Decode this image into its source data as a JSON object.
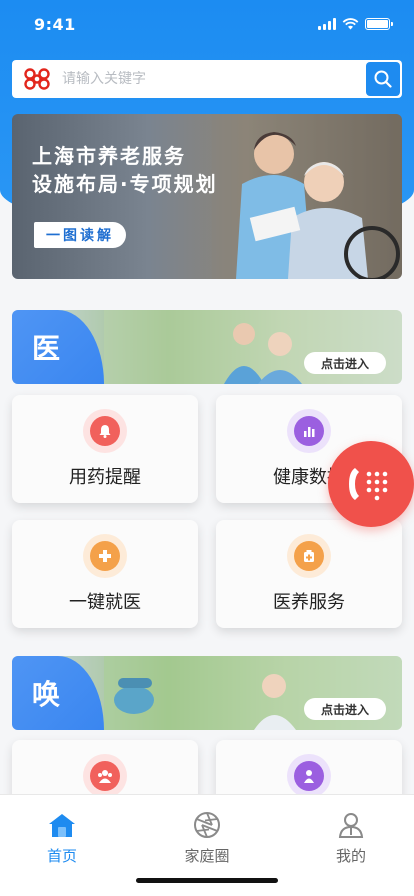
{
  "status": {
    "time": "9:41"
  },
  "search": {
    "placeholder": "请输入关键字",
    "value": ""
  },
  "banner": {
    "title_line1": "上海市养老服务",
    "title_line2": "设施布局·专项规划",
    "button_label": "一图读解"
  },
  "sections": [
    {
      "tag": "医",
      "enter_label": "点击进入"
    },
    {
      "tag": "唤",
      "enter_label": "点击进入"
    }
  ],
  "cards": [
    {
      "label": "用药提醒",
      "icon": "bell-icon",
      "color": "#f1615c",
      "glow": "#fde3e2"
    },
    {
      "label": "健康数据",
      "icon": "bar-chart-icon",
      "color": "#9b5fe0",
      "glow": "#ece2fb"
    },
    {
      "label": "一键就医",
      "icon": "medical-cross-icon",
      "color": "#f4a14a",
      "glow": "#fdebd8"
    },
    {
      "label": "医养服务",
      "icon": "medicine-box-icon",
      "color": "#f4a14a",
      "glow": "#fdebd8"
    },
    {
      "label": "",
      "icon": "group-icon",
      "color": "#f1615c",
      "glow": "#fde3e2"
    },
    {
      "label": "",
      "icon": "person-icon",
      "color": "#9b5fe0",
      "glow": "#ece2fb"
    }
  ],
  "fab": {
    "icon": "phone-dialpad-icon",
    "color": "#f0514b"
  },
  "tabbar": {
    "items": [
      {
        "label": "首页",
        "icon": "home-icon",
        "active": true
      },
      {
        "label": "家庭圈",
        "icon": "aperture-icon",
        "active": false
      },
      {
        "label": "我的",
        "icon": "user-icon",
        "active": false
      }
    ]
  },
  "colors": {
    "primary": "#1e8bf0",
    "accent_red": "#f0514b"
  }
}
